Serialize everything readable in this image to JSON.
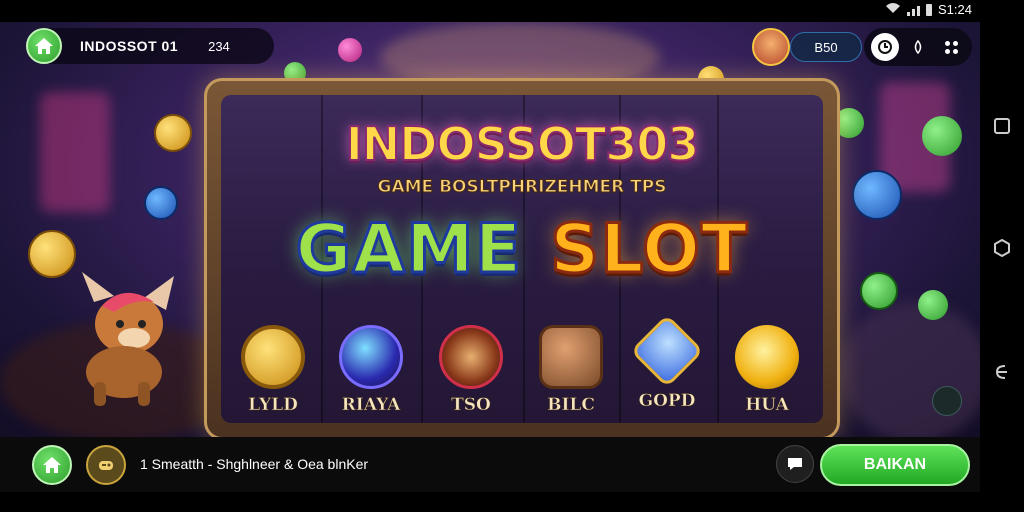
{
  "status": {
    "time": "S1:24"
  },
  "hud": {
    "title": "INDOSSOT 01",
    "counter": "234",
    "coin_balance": "B50"
  },
  "banner": {
    "logo": "INDOSSOT303",
    "subtitle": "GAME BOSLTPHRIZEHMER TPS",
    "word_game": "GAME",
    "word_slot": "SLOT"
  },
  "symbols": [
    {
      "label": "LYLD",
      "icon": "gold-medal-icon"
    },
    {
      "label": "RIAYA",
      "icon": "blue-orb-icon"
    },
    {
      "label": "TSO",
      "icon": "red-bow-icon"
    },
    {
      "label": "BILC",
      "icon": "treasure-pot-icon"
    },
    {
      "label": "GOPD",
      "icon": "blue-gem-icon"
    },
    {
      "label": "HUA",
      "icon": "gold-crown-icon"
    }
  ],
  "bottom_bar": {
    "info_text": "1 Smeatth - Shghlneer & Oea blnKer",
    "action_label": "BAIKAN"
  },
  "colors": {
    "accent_green": "#2f9e2c",
    "frame_gold": "#c49a5c",
    "bg_purple": "#3a2360"
  }
}
